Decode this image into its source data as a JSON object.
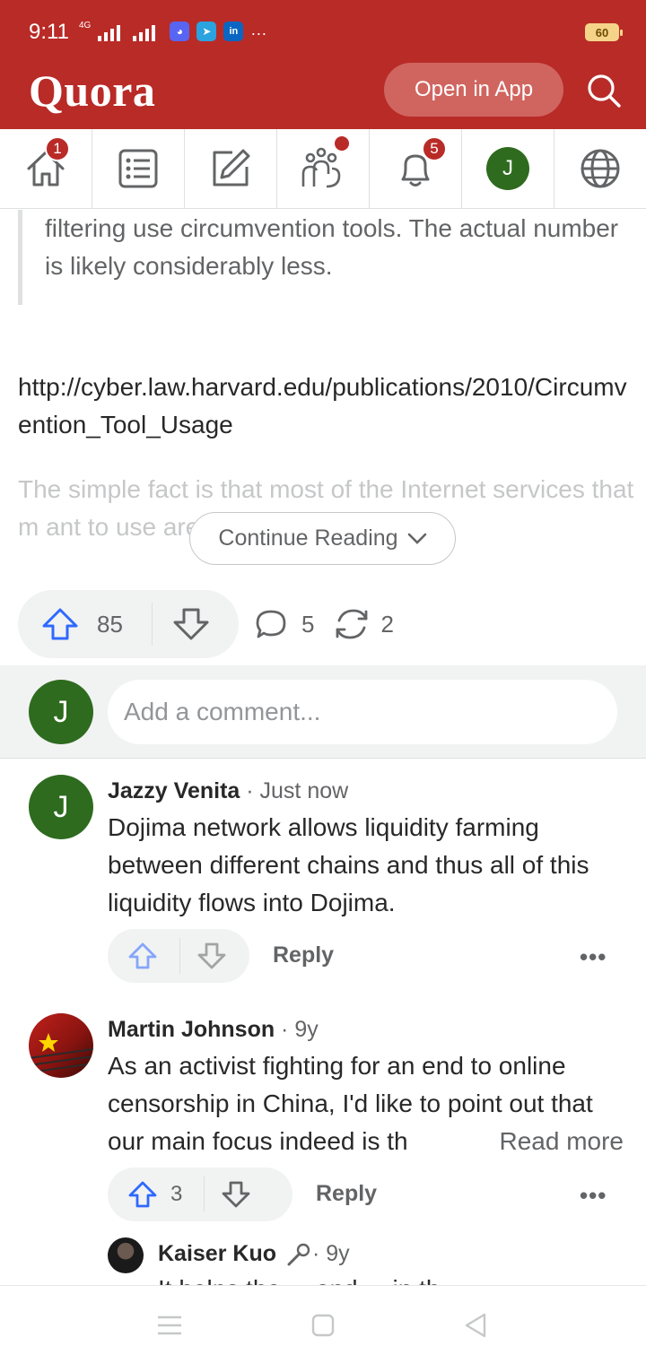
{
  "status_bar": {
    "time": "9:11",
    "network": "4G",
    "apps": [
      "discord-icon",
      "telegram-icon",
      "linkedin-icon"
    ],
    "more": "···",
    "battery": "60"
  },
  "header": {
    "logo": "Quora",
    "open_in_app": "Open in App"
  },
  "nav": {
    "home_badge": "1",
    "notifications_badge": "5",
    "profile_initial": "J"
  },
  "answer": {
    "quote_text": "filtering use circumvention tools. The actual number is likely considerably less.",
    "link": "http://cyber.law.harvard.edu/publications/2010/Circumvention_Tool_Usage",
    "faded_text": "The simple fact is that most of the Internet services that m                                   ant to use are (sur",
    "continue_reading": "Continue Reading",
    "upvotes": "85",
    "comments": "5",
    "shares": "2"
  },
  "comment_box": {
    "avatar_initial": "J",
    "placeholder": "Add a comment..."
  },
  "comments": [
    {
      "author": "Jazzy Venita",
      "meta": " · Just now",
      "avatar_initial": "J",
      "body": "Dojima network allows liquidity farming between different chains and thus all of this liquidity flows into Dojima.",
      "reply": "Reply",
      "more": "•••"
    },
    {
      "author": "Martin Johnson",
      "meta": " · 9y",
      "body": "As an activist fighting for an end to online censorship in China, I'd like to point out that our main focus indeed is th",
      "read_more": "Read more",
      "upvotes": "3",
      "reply": "Reply",
      "more": "•••"
    },
    {
      "author": "Kaiser Kuo",
      "meta": " · 9y",
      "body_partial": "It helps the ... and ... in th"
    }
  ],
  "colors": {
    "brand": "#b92b27",
    "upvote_blue": "#2e69ff",
    "avatar_green": "#2e6b1e"
  }
}
